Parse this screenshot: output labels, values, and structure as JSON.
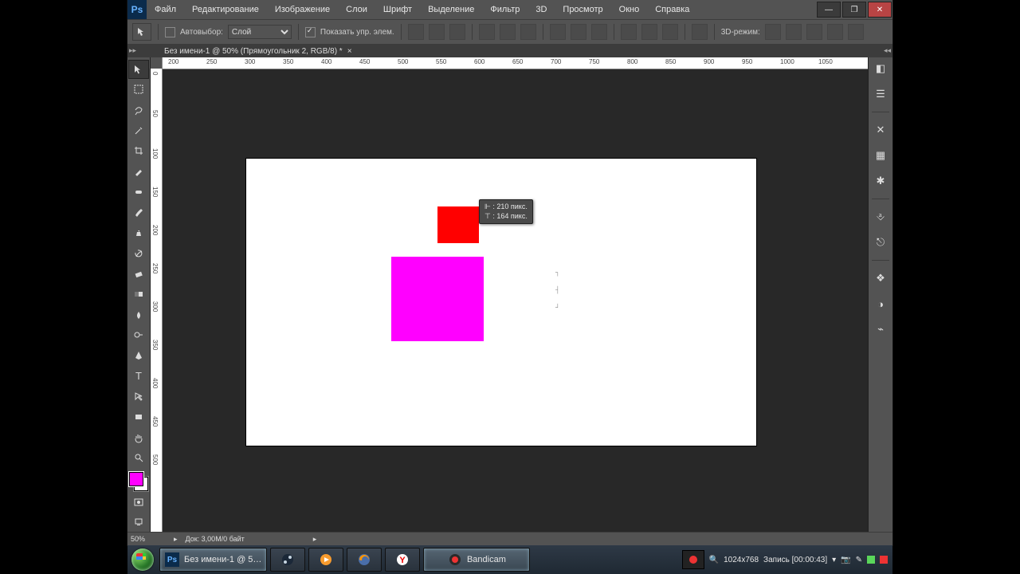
{
  "menu": {
    "items": [
      "Файл",
      "Редактирование",
      "Изображение",
      "Слои",
      "Шрифт",
      "Выделение",
      "Фильтр",
      "3D",
      "Просмотр",
      "Окно",
      "Справка"
    ]
  },
  "optionsbar": {
    "auto_select_label": "Автовыбор:",
    "auto_select_value": "Слой",
    "show_transform_label": "Показать упр. элем.",
    "mode_3d_label": "3D-режим:"
  },
  "tab": {
    "title": "Без имени-1 @ 50% (Прямоугольник 2, RGB/8) *"
  },
  "ruler": {
    "h_ticks": [
      "200",
      "250",
      "300",
      "350",
      "400",
      "450",
      "500",
      "550",
      "600",
      "650",
      "700",
      "750",
      "800",
      "850",
      "900",
      "950",
      "1000",
      "1050"
    ],
    "v_ticks": [
      "0",
      "50",
      "100",
      "150",
      "200",
      "250",
      "300",
      "350",
      "400",
      "450",
      "500"
    ]
  },
  "tooltip": {
    "w_label": "⊩ :",
    "w_value": "210 пикс.",
    "h_label": "⊤ :",
    "h_value": "164 пикс."
  },
  "colors": {
    "red": "#ff0000",
    "magenta": "#ff00ff",
    "foreground": "#ff00ff",
    "background": "#ffffff"
  },
  "status": {
    "zoom": "50%",
    "doc": "Док: 3,00M/0 байт"
  },
  "taskbar": {
    "ps_doc": "Без имени-1 @ 5…",
    "bandicam": "Bandicam",
    "resolution": "1024x768",
    "record": "Запись [00:00:43]"
  }
}
